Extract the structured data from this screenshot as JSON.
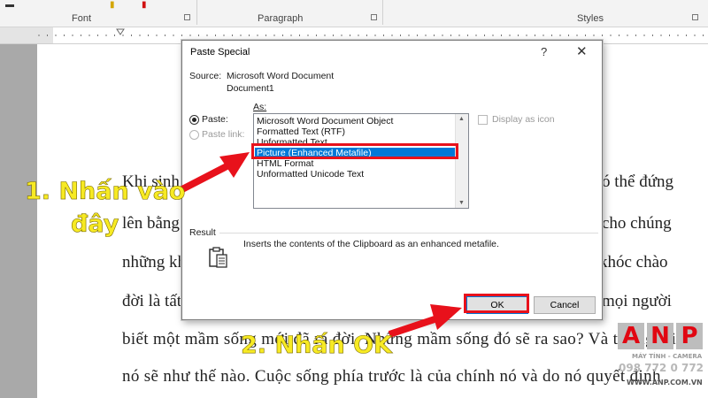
{
  "ribbon": {
    "groups": [
      "Font",
      "Paragraph",
      "Styles"
    ]
  },
  "document": {
    "lines": [
      "Khi sinh",
      "ó thể đứng",
      "lên bằng",
      "cho chúng",
      "những kh",
      "khóc chào",
      "đời là tất",
      "mọi người",
      "biết một mầm sống mới đã ra đời. Những mầm sống đó sẽ ra sao? Và tương lai",
      "nó sẽ như thế nào. Cuộc sống phía trước là của chính nó và do nó quyết định"
    ]
  },
  "dialog": {
    "title": "Paste Special",
    "help": "?",
    "close": "✕",
    "source_label": "Source:",
    "source_value": "Microsoft Word Document",
    "source_doc": "Document1",
    "as_label": "As:",
    "paste_label": "Paste:",
    "paste_link_label": "Paste link:",
    "formats": [
      "Microsoft Word Document Object",
      "Formatted Text (RTF)",
      "Unformatted Text",
      "Picture (Enhanced Metafile)",
      "HTML Format",
      "Unformatted Unicode Text"
    ],
    "selected_index": 3,
    "display_as_icon": "Display as icon",
    "result_label": "Result",
    "result_text": "Inserts the contents of the Clipboard as an enhanced metafile.",
    "ok": "OK",
    "cancel": "Cancel"
  },
  "annotations": {
    "step1_line1": "1. Nhấn vào",
    "step1_line2": "đây",
    "step2": "2. Nhấn OK"
  },
  "logo": {
    "letters": [
      "A",
      "N",
      "P"
    ],
    "tagline": "MÁY TÍNH - CAMERA",
    "phone": "098 772 0 772",
    "website": "WWW.ANP.COM.VN"
  },
  "colors": {
    "annotation_text": "#f7ea23",
    "highlight": "#e8111b",
    "selection": "#0078d7"
  }
}
